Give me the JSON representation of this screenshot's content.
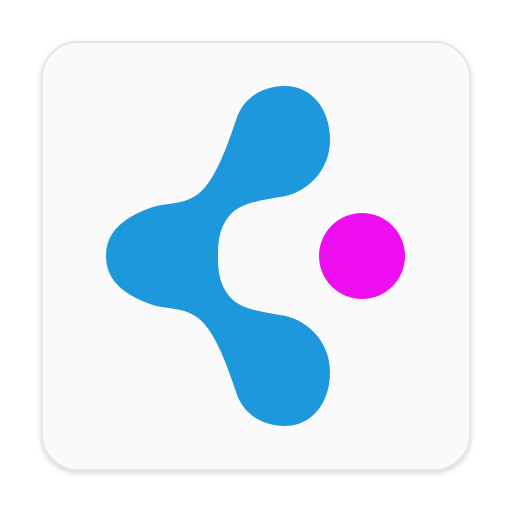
{
  "icon": {
    "name": "app-launcher-icon",
    "background_color": "#fafafa",
    "border_color": "#e3e3e3",
    "shape_color": "#1e98dd",
    "dot_color": "#ee0cf0"
  }
}
